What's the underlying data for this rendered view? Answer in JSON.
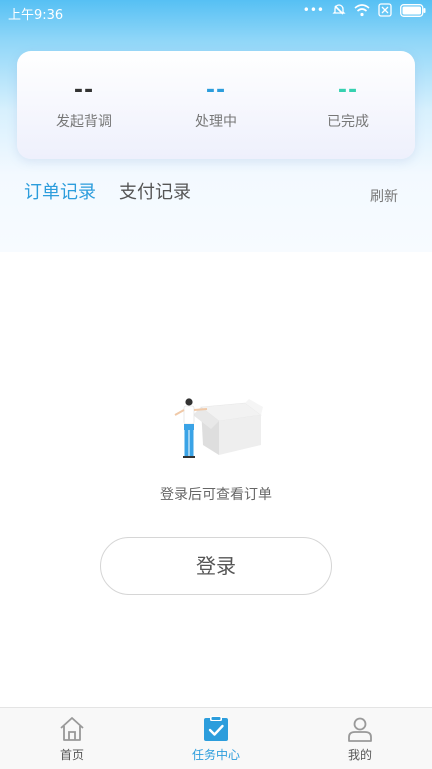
{
  "status_bar": {
    "time": "上午9:36",
    "dots": "•••"
  },
  "stats": [
    {
      "value": "--",
      "label": "发起背调",
      "color": "#333333"
    },
    {
      "value": "--",
      "label": "处理中",
      "color": "#2c9ddc"
    },
    {
      "value": "--",
      "label": "已完成",
      "color": "#36d1b0"
    }
  ],
  "tabs": {
    "active": "订单记录",
    "inactive": "支付记录",
    "refresh": "刷新"
  },
  "empty_state": {
    "message": "登录后可查看订单",
    "button": "登录"
  },
  "bottom_nav": [
    {
      "label": "首页",
      "icon": "home-icon"
    },
    {
      "label": "任务中心",
      "icon": "task-check-icon",
      "active": true
    },
    {
      "label": "我的",
      "icon": "person-icon"
    }
  ],
  "colors": {
    "accent": "#2c9ddc",
    "header_top": "#56c0f4"
  }
}
